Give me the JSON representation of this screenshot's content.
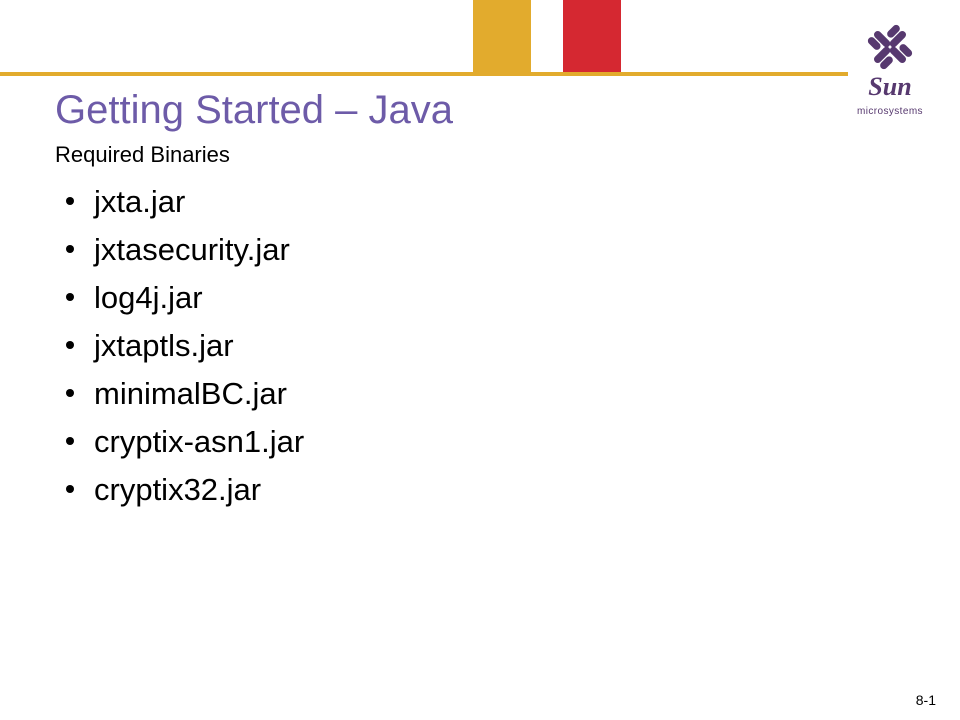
{
  "header": {
    "logo_caption": "microsystems"
  },
  "slide": {
    "title": "Getting Started – Java",
    "subtitle": "Required Binaries",
    "bullets": [
      "jxta.jar",
      "jxtasecurity.jar",
      "log4j.jar",
      "jxtaptls.jar",
      "minimalBC.jar",
      "cryptix-asn1.jar",
      "cryptix32.jar"
    ]
  },
  "page_number": "8-1"
}
